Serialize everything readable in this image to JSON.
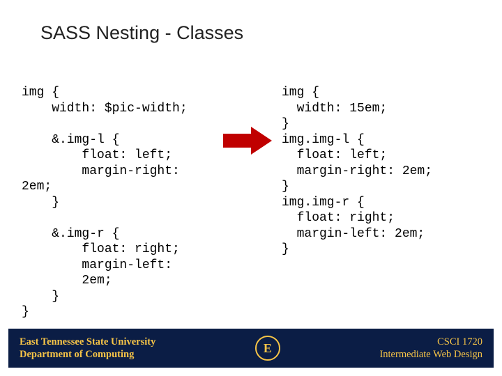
{
  "title": "SASS Nesting - Classes",
  "code": {
    "sass": "img {\n    width: $pic-width;\n\n    &.img-l {\n        float: left;\n        margin-right:\n2em;\n    }\n\n    &.img-r {\n        float: right;\n        margin-left:\n        2em;\n    }\n}",
    "css": "img {\n  width: 15em;\n}\nimg.img-l {\n  float: left;\n  margin-right: 2em;\n}\nimg.img-r {\n  float: right;\n  margin-left: 2em;\n}"
  },
  "arrow": {
    "color": "#c00000"
  },
  "footer": {
    "institution_line1": "East Tennessee State University",
    "institution_line2": "Department of Computing",
    "course_code": "CSCI 1720",
    "course_title": "Intermediate Web Design",
    "logo_letter": "E"
  }
}
